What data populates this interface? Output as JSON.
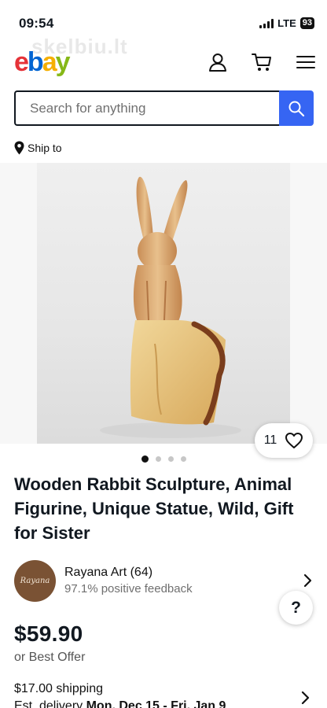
{
  "status_bar": {
    "time": "09:54",
    "network": "LTE",
    "battery": "93"
  },
  "watermark": "skelbiu.lt",
  "header": {
    "logo": {
      "e": "e",
      "b": "b",
      "a": "a",
      "y": "y"
    },
    "search_placeholder": "Search for anything",
    "ship_to": "Ship to"
  },
  "gallery": {
    "watch_count": "11",
    "images_total": 4,
    "active_index": 0
  },
  "listing": {
    "title": "Wooden Rabbit Sculpture, Animal Figurine, Unique Statue, Wild, Gift for Sister",
    "price": "$59.90",
    "best_offer": "or Best Offer",
    "shipping": "$17.00 shipping",
    "delivery_prefix": "Est. delivery",
    "delivery_dates": "Mon, Dec 15 - Fri, Jan 9"
  },
  "seller": {
    "avatar_text": "Rayana",
    "name_line": "Rayana Art (64)",
    "feedback": "97.1% positive feedback"
  },
  "help_label": "?",
  "colors": {
    "brand_blue": "#3665f3",
    "text": "#111820",
    "muted": "#707070"
  }
}
